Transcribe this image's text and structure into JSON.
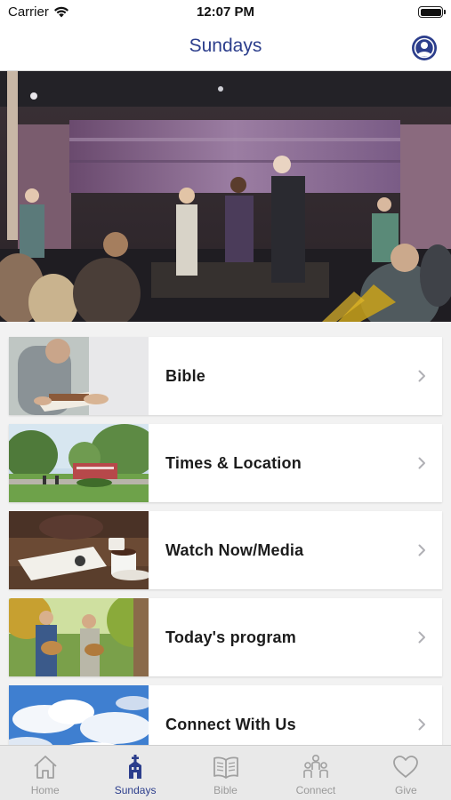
{
  "status_bar": {
    "carrier": "Carrier",
    "time": "12:07 PM",
    "wifi_icon": "wifi-icon",
    "battery_icon": "battery-icon"
  },
  "nav": {
    "title": "Sundays",
    "profile_icon": "user-profile-icon"
  },
  "hero": {
    "image": "church-stage-worship-photo"
  },
  "menu_items": [
    {
      "label": "Bible",
      "thumbnail": "people-reading-bible-photo"
    },
    {
      "label": "Times & Location",
      "thumbnail": "church-sign-lawn-photo"
    },
    {
      "label": "Watch Now/Media",
      "thumbnail": "coffee-and-tablet-photo"
    },
    {
      "label": "Today's program",
      "thumbnail": "guitar-players-outdoors-photo"
    },
    {
      "label": "Connect With Us",
      "thumbnail": "blue-sky-clouds-photo"
    }
  ],
  "tab_bar": {
    "tabs": [
      {
        "label": "Home",
        "icon": "home-icon",
        "active": false
      },
      {
        "label": "Sundays",
        "icon": "church-icon",
        "active": true
      },
      {
        "label": "Bible",
        "icon": "book-icon",
        "active": false
      },
      {
        "label": "Connect",
        "icon": "people-icon",
        "active": false
      },
      {
        "label": "Give",
        "icon": "heart-icon",
        "active": false
      }
    ]
  },
  "colors": {
    "accent": "#2c3e8c",
    "tab_inactive": "#9a9a9a",
    "background": "#f2f2f2"
  }
}
